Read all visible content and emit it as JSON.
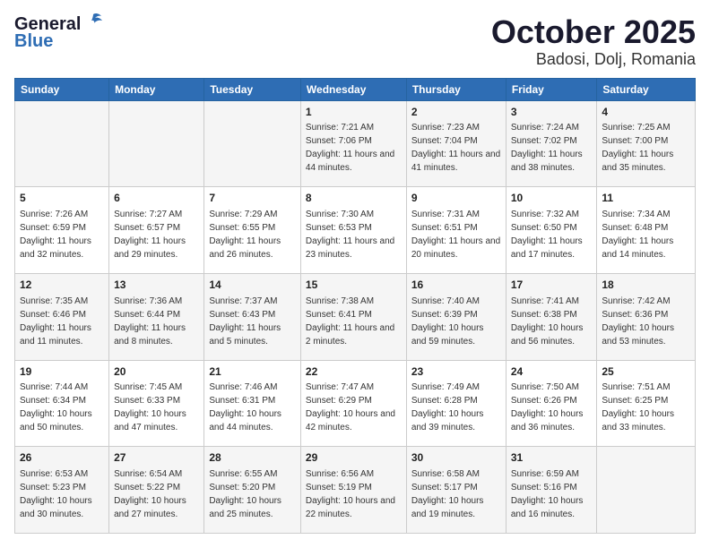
{
  "header": {
    "logo_general": "General",
    "logo_blue": "Blue",
    "title": "October 2025",
    "subtitle": "Badosi, Dolj, Romania"
  },
  "days_of_week": [
    "Sunday",
    "Monday",
    "Tuesday",
    "Wednesday",
    "Thursday",
    "Friday",
    "Saturday"
  ],
  "weeks": [
    [
      {
        "day": "",
        "info": ""
      },
      {
        "day": "",
        "info": ""
      },
      {
        "day": "",
        "info": ""
      },
      {
        "day": "1",
        "info": "Sunrise: 7:21 AM\nSunset: 7:06 PM\nDaylight: 11 hours and 44 minutes."
      },
      {
        "day": "2",
        "info": "Sunrise: 7:23 AM\nSunset: 7:04 PM\nDaylight: 11 hours and 41 minutes."
      },
      {
        "day": "3",
        "info": "Sunrise: 7:24 AM\nSunset: 7:02 PM\nDaylight: 11 hours and 38 minutes."
      },
      {
        "day": "4",
        "info": "Sunrise: 7:25 AM\nSunset: 7:00 PM\nDaylight: 11 hours and 35 minutes."
      }
    ],
    [
      {
        "day": "5",
        "info": "Sunrise: 7:26 AM\nSunset: 6:59 PM\nDaylight: 11 hours and 32 minutes."
      },
      {
        "day": "6",
        "info": "Sunrise: 7:27 AM\nSunset: 6:57 PM\nDaylight: 11 hours and 29 minutes."
      },
      {
        "day": "7",
        "info": "Sunrise: 7:29 AM\nSunset: 6:55 PM\nDaylight: 11 hours and 26 minutes."
      },
      {
        "day": "8",
        "info": "Sunrise: 7:30 AM\nSunset: 6:53 PM\nDaylight: 11 hours and 23 minutes."
      },
      {
        "day": "9",
        "info": "Sunrise: 7:31 AM\nSunset: 6:51 PM\nDaylight: 11 hours and 20 minutes."
      },
      {
        "day": "10",
        "info": "Sunrise: 7:32 AM\nSunset: 6:50 PM\nDaylight: 11 hours and 17 minutes."
      },
      {
        "day": "11",
        "info": "Sunrise: 7:34 AM\nSunset: 6:48 PM\nDaylight: 11 hours and 14 minutes."
      }
    ],
    [
      {
        "day": "12",
        "info": "Sunrise: 7:35 AM\nSunset: 6:46 PM\nDaylight: 11 hours and 11 minutes."
      },
      {
        "day": "13",
        "info": "Sunrise: 7:36 AM\nSunset: 6:44 PM\nDaylight: 11 hours and 8 minutes."
      },
      {
        "day": "14",
        "info": "Sunrise: 7:37 AM\nSunset: 6:43 PM\nDaylight: 11 hours and 5 minutes."
      },
      {
        "day": "15",
        "info": "Sunrise: 7:38 AM\nSunset: 6:41 PM\nDaylight: 11 hours and 2 minutes."
      },
      {
        "day": "16",
        "info": "Sunrise: 7:40 AM\nSunset: 6:39 PM\nDaylight: 10 hours and 59 minutes."
      },
      {
        "day": "17",
        "info": "Sunrise: 7:41 AM\nSunset: 6:38 PM\nDaylight: 10 hours and 56 minutes."
      },
      {
        "day": "18",
        "info": "Sunrise: 7:42 AM\nSunset: 6:36 PM\nDaylight: 10 hours and 53 minutes."
      }
    ],
    [
      {
        "day": "19",
        "info": "Sunrise: 7:44 AM\nSunset: 6:34 PM\nDaylight: 10 hours and 50 minutes."
      },
      {
        "day": "20",
        "info": "Sunrise: 7:45 AM\nSunset: 6:33 PM\nDaylight: 10 hours and 47 minutes."
      },
      {
        "day": "21",
        "info": "Sunrise: 7:46 AM\nSunset: 6:31 PM\nDaylight: 10 hours and 44 minutes."
      },
      {
        "day": "22",
        "info": "Sunrise: 7:47 AM\nSunset: 6:29 PM\nDaylight: 10 hours and 42 minutes."
      },
      {
        "day": "23",
        "info": "Sunrise: 7:49 AM\nSunset: 6:28 PM\nDaylight: 10 hours and 39 minutes."
      },
      {
        "day": "24",
        "info": "Sunrise: 7:50 AM\nSunset: 6:26 PM\nDaylight: 10 hours and 36 minutes."
      },
      {
        "day": "25",
        "info": "Sunrise: 7:51 AM\nSunset: 6:25 PM\nDaylight: 10 hours and 33 minutes."
      }
    ],
    [
      {
        "day": "26",
        "info": "Sunrise: 6:53 AM\nSunset: 5:23 PM\nDaylight: 10 hours and 30 minutes."
      },
      {
        "day": "27",
        "info": "Sunrise: 6:54 AM\nSunset: 5:22 PM\nDaylight: 10 hours and 27 minutes."
      },
      {
        "day": "28",
        "info": "Sunrise: 6:55 AM\nSunset: 5:20 PM\nDaylight: 10 hours and 25 minutes."
      },
      {
        "day": "29",
        "info": "Sunrise: 6:56 AM\nSunset: 5:19 PM\nDaylight: 10 hours and 22 minutes."
      },
      {
        "day": "30",
        "info": "Sunrise: 6:58 AM\nSunset: 5:17 PM\nDaylight: 10 hours and 19 minutes."
      },
      {
        "day": "31",
        "info": "Sunrise: 6:59 AM\nSunset: 5:16 PM\nDaylight: 10 hours and 16 minutes."
      },
      {
        "day": "",
        "info": ""
      }
    ]
  ]
}
